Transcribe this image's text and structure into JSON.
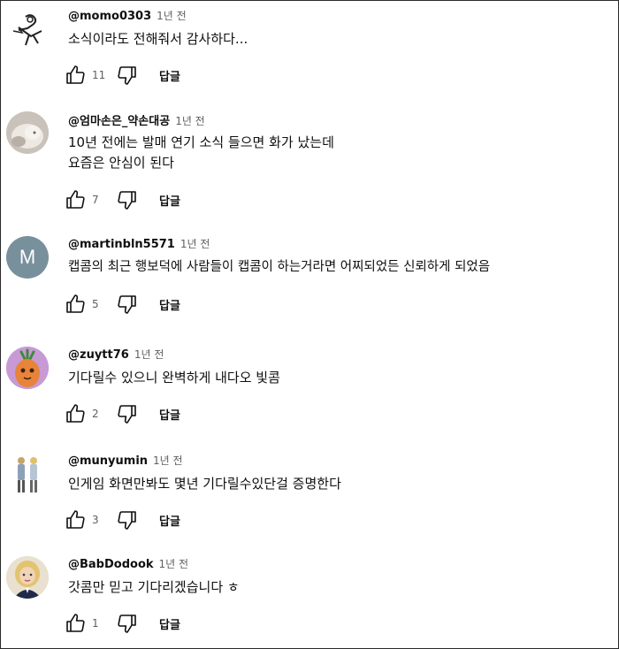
{
  "comments": [
    {
      "author": "@momo0303",
      "time": "1년 전",
      "lines": [
        "소식이라도 전해줘서 감사하다..."
      ],
      "likes": "11",
      "reply": "답글",
      "avatar": {
        "kind": "doodle",
        "icon": "doodle-avatar-icon"
      }
    },
    {
      "author": "@엄마손은_약손대공",
      "time": "1년 전",
      "lines": [
        "10년 전에는 발매 연기 소식 들으면 화가 났는데",
        "요즘은 안심이 된다"
      ],
      "likes": "7",
      "reply": "답글",
      "avatar": {
        "kind": "photo",
        "icon": "cat-photo-avatar-icon"
      }
    },
    {
      "author": "@martinbln5571",
      "time": "1년 전",
      "lines": [
        "캡콤의 최근 행보덕에 사람들이 캡콤이 하는거라면 어찌되었든 신뢰하게 되었음"
      ],
      "likes": "5",
      "reply": "답글",
      "avatar": {
        "kind": "letter",
        "letter": "M",
        "color": "#78909c",
        "icon": "letter-avatar-icon"
      }
    },
    {
      "author": "@zuytt76",
      "time": "1년 전",
      "lines": [
        "기다릴수 있으니 완벽하게 내다오 빛콤"
      ],
      "likes": "2",
      "reply": "답글",
      "avatar": {
        "kind": "carrot",
        "icon": "carrot-character-avatar-icon"
      }
    },
    {
      "author": "@munyumin",
      "time": "1년 전",
      "lines": [
        "인게임 화면만봐도 몇년 기다릴수있단걸 증명한다"
      ],
      "likes": "3",
      "reply": "답글",
      "avatar": {
        "kind": "figures",
        "icon": "two-figures-avatar-icon"
      }
    },
    {
      "author": "@BabDodook",
      "time": "1년 전",
      "lines": [
        "갓콤만 믿고 기다리겠습니다 ㅎ"
      ],
      "likes": "1",
      "reply": "답글",
      "avatar": {
        "kind": "portrait",
        "icon": "portrait-avatar-icon"
      }
    }
  ],
  "colors": {
    "text": "#0f0f0f",
    "meta": "#606060",
    "background": "#ffffff"
  }
}
